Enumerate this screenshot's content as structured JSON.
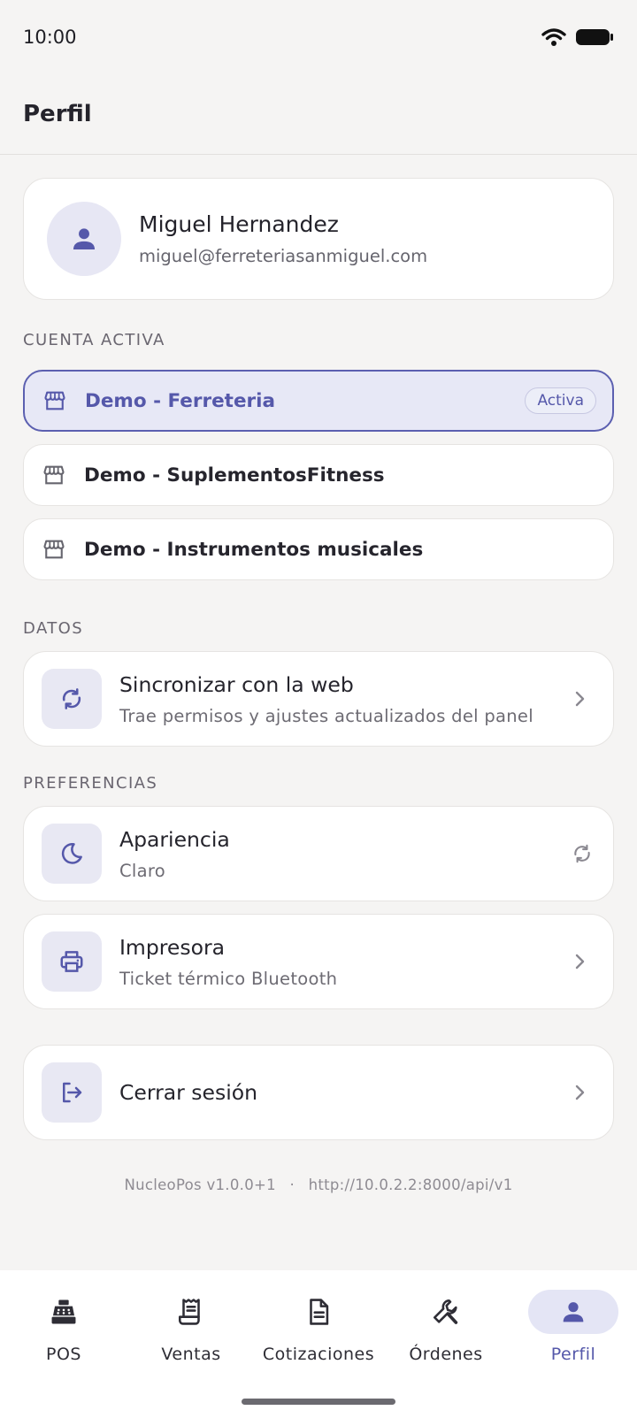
{
  "status_bar": {
    "time": "10:00"
  },
  "header": {
    "title": "Perfil"
  },
  "profile": {
    "name": "Miguel Hernandez",
    "email": "miguel@ferreteriasanmiguel.com"
  },
  "accounts_section": {
    "label": "CUENTA ACTIVA",
    "items": [
      {
        "label": "Demo - Ferreteria",
        "active": true,
        "badge": "Activa"
      },
      {
        "label": "Demo - SuplementosFitness",
        "active": false
      },
      {
        "label": "Demo - Instrumentos musicales",
        "active": false
      }
    ]
  },
  "data_section": {
    "label": "DATOS",
    "sync": {
      "title": "Sincronizar con la web",
      "subtitle": "Trae permisos y ajustes actualizados del panel"
    }
  },
  "preferences_section": {
    "label": "PREFERENCIAS",
    "appearance": {
      "title": "Apariencia",
      "subtitle": "Claro"
    },
    "printer": {
      "title": "Impresora",
      "subtitle": "Ticket térmico Bluetooth"
    }
  },
  "logout": {
    "title": "Cerrar sesión"
  },
  "footer": {
    "app_version": "NucleoPos v1.0.0+1",
    "separator": "·",
    "api_url": "http://10.0.2.2:8000/api/v1"
  },
  "bottom_nav": {
    "items": [
      {
        "label": "POS",
        "icon": "cash-register-icon"
      },
      {
        "label": "Ventas",
        "icon": "receipt-icon"
      },
      {
        "label": "Cotizaciones",
        "icon": "document-icon"
      },
      {
        "label": "Órdenes",
        "icon": "wrench-icon"
      },
      {
        "label": "Perfil",
        "icon": "person-icon",
        "selected": true
      }
    ]
  },
  "colors": {
    "accent": "#5558aa",
    "accent_bg": "#e7e8f6",
    "background": "#f5f4f3"
  }
}
